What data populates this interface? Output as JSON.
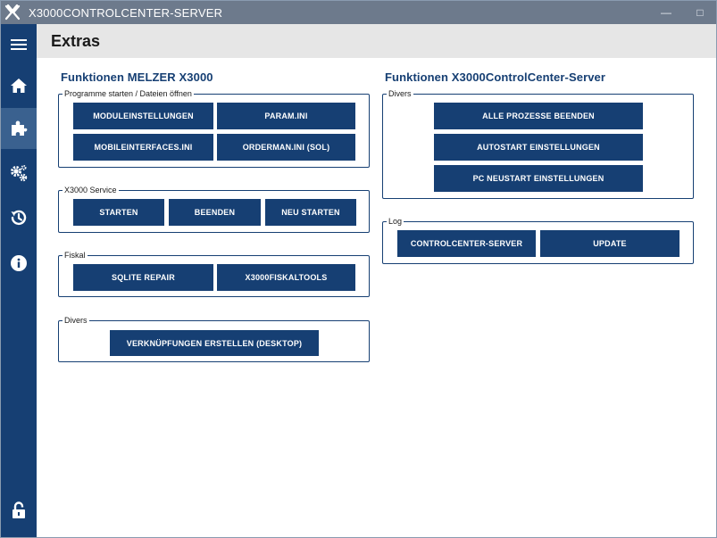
{
  "window": {
    "title": "X3000CONTROLCENTER-SERVER",
    "minimize_glyph": "—",
    "maximize_glyph": "□"
  },
  "header": {
    "title": "Extras"
  },
  "sidebar": {
    "items": [
      {
        "name": "menu",
        "icon": "hamburger-menu-icon"
      },
      {
        "name": "home",
        "icon": "home-icon"
      },
      {
        "name": "extras",
        "icon": "puzzle-icon",
        "active": true
      },
      {
        "name": "settings",
        "icon": "gears-icon"
      },
      {
        "name": "history",
        "icon": "history-icon"
      },
      {
        "name": "info",
        "icon": "info-icon"
      },
      {
        "name": "lock",
        "icon": "lock-icon"
      }
    ]
  },
  "left": {
    "title": "Funktionen MELZER X3000",
    "programs": {
      "legend": "Programme starten / Dateien öffnen",
      "buttons": [
        "MODULEINSTELLUNGEN",
        "PARAM.INI",
        "MOBILEINTERFACES.INI",
        "ORDERMAN.INI (SOL)"
      ]
    },
    "service": {
      "legend": "X3000 Service",
      "buttons": [
        "STARTEN",
        "BEENDEN",
        "NEU STARTEN"
      ]
    },
    "fiskal": {
      "legend": "Fiskal",
      "buttons": [
        "SQLITE REPAIR",
        "X3000FISKALTOOLS"
      ]
    },
    "divers": {
      "legend": "Divers",
      "buttons": [
        "VERKNÜPFUNGEN ERSTELLEN (DESKTOP)"
      ]
    }
  },
  "right": {
    "title": "Funktionen X3000ControlCenter-Server",
    "divers": {
      "legend": "Divers",
      "buttons": [
        "ALLE PROZESSE BEENDEN",
        "AUTOSTART EINSTELLUNGEN",
        "PC NEUSTART EINSTELLUNGEN"
      ]
    },
    "log": {
      "legend": "Log",
      "buttons": [
        "CONTROLCENTER-SERVER",
        "UPDATE"
      ]
    }
  },
  "colors": {
    "primary": "#163f73",
    "titlebar": "#6d7a8c",
    "sidebar_active": "#3a618f",
    "header_bg": "#e6e6e6"
  }
}
